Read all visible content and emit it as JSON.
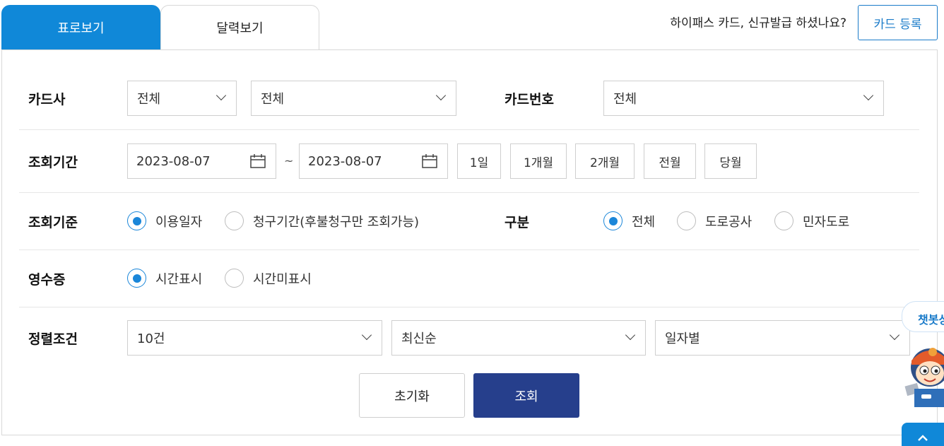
{
  "tabs": {
    "table_view": "표로보기",
    "calendar_view": "달력보기"
  },
  "notice": "하이패스 카드, 신규발급 하셨나요?",
  "register_button": "카드 등록",
  "form": {
    "card_company": {
      "label": "카드사",
      "select1": "전체",
      "select2": "전체"
    },
    "card_number": {
      "label": "카드번호",
      "value": "전체"
    },
    "period": {
      "label": "조회기간",
      "start_date": "2023-08-07",
      "separator": "~",
      "end_date": "2023-08-07",
      "buttons": [
        "1일",
        "1개월",
        "2개월",
        "전월",
        "당월"
      ]
    },
    "criteria": {
      "label": "조회기준",
      "options": [
        {
          "label": "이용일자",
          "checked": true
        },
        {
          "label": "청구기간(후불청구만 조회가능)",
          "checked": false
        }
      ]
    },
    "category": {
      "label": "구분",
      "options": [
        {
          "label": "전체",
          "checked": true
        },
        {
          "label": "도로공사",
          "checked": false
        },
        {
          "label": "민자도로",
          "checked": false
        }
      ]
    },
    "receipt": {
      "label": "영수증",
      "options": [
        {
          "label": "시간표시",
          "checked": true
        },
        {
          "label": "시간미표시",
          "checked": false
        }
      ]
    },
    "sort": {
      "label": "정렬조건",
      "count": "10건",
      "order": "최신순",
      "group": "일자별"
    }
  },
  "buttons": {
    "reset": "초기화",
    "search": "조회"
  },
  "chatbot": {
    "label": "챗봇상"
  },
  "colors": {
    "primary": "#1088d8",
    "navy": "#263f8c",
    "radio": "#1a86d9"
  }
}
